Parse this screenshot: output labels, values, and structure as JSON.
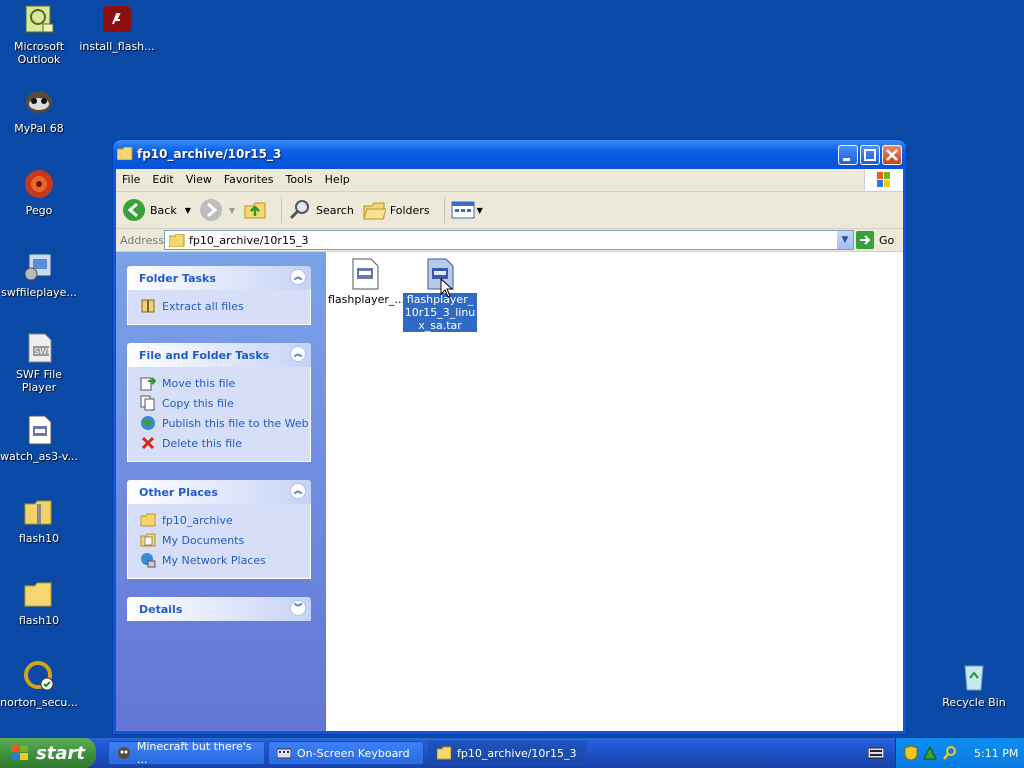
{
  "desktop": {
    "icons": [
      {
        "label": "Microsoft Outlook",
        "icon": "outlook-icon"
      },
      {
        "label": "install_flash...",
        "icon": "flash-installer-icon"
      },
      {
        "label": "MyPal 68",
        "icon": "mypal-icon"
      },
      {
        "label": "Pego",
        "icon": "pego-icon"
      },
      {
        "label": "swffileplaye...",
        "icon": "swf-player-installer-icon"
      },
      {
        "label": "SWF File Player",
        "icon": "swf-file-player-icon"
      },
      {
        "label": "watch_as3-v...",
        "icon": "document-icon"
      },
      {
        "label": "flash10",
        "icon": "zip-folder-icon"
      },
      {
        "label": "flash10",
        "icon": "folder-icon"
      },
      {
        "label": "norton_secu...",
        "icon": "norton-icon"
      },
      {
        "label": "Recycle Bin",
        "icon": "recycle-bin-icon"
      }
    ]
  },
  "window": {
    "title": "fp10_archive/10r15_3",
    "menu": [
      "File",
      "Edit",
      "View",
      "Favorites",
      "Tools",
      "Help"
    ],
    "toolbar": {
      "back": "Back",
      "search": "Search",
      "folders": "Folders"
    },
    "address": {
      "label": "Address",
      "value": "fp10_archive/10r15_3",
      "go": "Go"
    },
    "taskpane": {
      "folder_tasks": {
        "title": "Folder Tasks",
        "items": [
          "Extract all files"
        ]
      },
      "file_folder_tasks": {
        "title": "File and Folder Tasks",
        "items": [
          "Move this file",
          "Copy this file",
          "Publish this file to the Web",
          "Delete this file"
        ]
      },
      "other_places": {
        "title": "Other Places",
        "items": [
          "fp10_archive",
          "My Documents",
          "My Network Places"
        ]
      },
      "details": {
        "title": "Details"
      }
    },
    "files": [
      {
        "name": "flashplayer_...",
        "selected": false
      },
      {
        "name": "flashplayer_10r15_3_linux_sa.tar",
        "selected": true
      }
    ]
  },
  "taskbar": {
    "start": "start",
    "tasks": [
      {
        "label": "Minecraft but there's ...",
        "active": false
      },
      {
        "label": "On-Screen Keyboard",
        "active": false
      },
      {
        "label": "fp10_archive/10r15_3",
        "active": true
      }
    ],
    "clock": "5:11 PM"
  },
  "colors": {
    "desktop": "#0a4aa6",
    "link": "#215dc6",
    "selection": "#316ac5"
  }
}
